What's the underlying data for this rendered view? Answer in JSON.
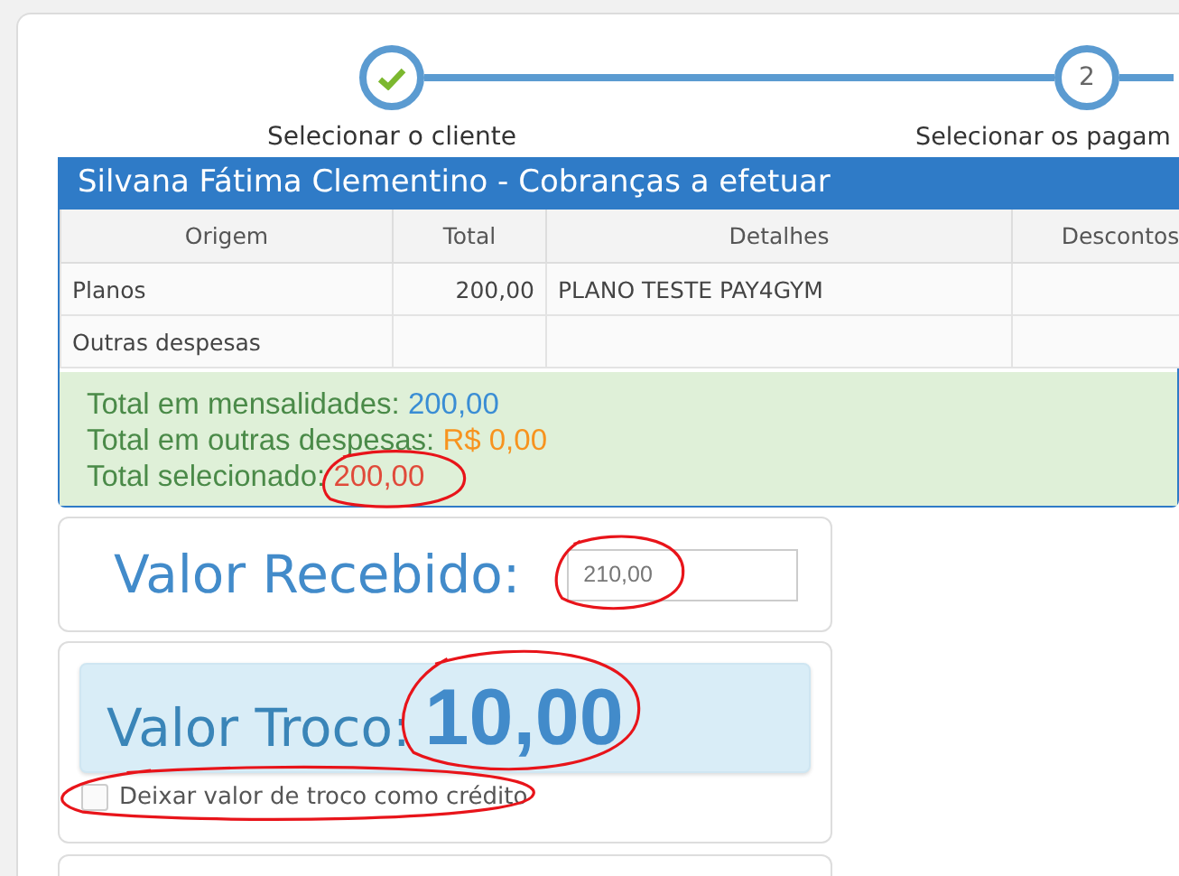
{
  "steps": [
    {
      "label": "Selecionar o cliente",
      "done": true
    },
    {
      "label": "Selecionar os pagam",
      "done": false,
      "number": "2"
    }
  ],
  "panel": {
    "title": "Silvana Fátima Clementino - Cobranças a efetuar",
    "table": {
      "columns": [
        "Origem",
        "Total",
        "Detalhes",
        "Descontos"
      ],
      "rows": [
        [
          "Planos",
          "200,00",
          "PLANO TESTE PAY4GYM",
          ""
        ],
        [
          "Outras despesas",
          "",
          "",
          ""
        ]
      ]
    },
    "summary": [
      {
        "label": "Total em mensalidades:",
        "value": "200,00",
        "color": "#3a8dd4"
      },
      {
        "label": "Total em outras despesas:",
        "value": "R$ 0,00",
        "color": "#f7931e"
      },
      {
        "label": "Total selecionado:",
        "value": "200,00",
        "color": "#e04a3a",
        "circled": true
      }
    ]
  },
  "received": {
    "label": "Valor Recebido:",
    "value": "210,00",
    "circled": true
  },
  "change": {
    "label": "Valor Troco:",
    "value": "10,00",
    "circled": true
  },
  "credit_option": {
    "label": "Deixar valor de troco como crédito",
    "checked": false,
    "circled": true
  }
}
